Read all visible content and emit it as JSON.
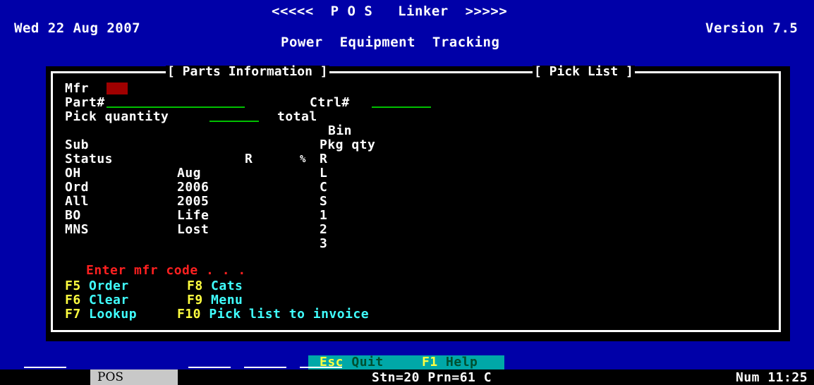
{
  "header": {
    "date": "Wed 22 Aug 2007",
    "title": "<<<<<  P O S   Linker  >>>>>",
    "subtitle": "Power  Equipment  Tracking",
    "version": "Version 7.5"
  },
  "panel": {
    "parts_title": "[ Parts Information ]",
    "picklist_title": "[ Pick List ]"
  },
  "fields": {
    "mfr_label": "Mfr",
    "part_label": "Part#",
    "ctrl_label": "Ctrl#",
    "pick_qty_label": "Pick quantity",
    "total_label": "total"
  },
  "labels": {
    "bin": "Bin",
    "sub": "Sub",
    "pkg_qty": "Pkg qty",
    "status": "Status",
    "r_col": "R",
    "pct": "%",
    "r2": "R",
    "rows_left": [
      "OH",
      "Ord",
      "All",
      "BO",
      "MNS"
    ],
    "rows_mid": [
      "Aug",
      "2006",
      "2005",
      "Life",
      "Lost"
    ],
    "rows_right": [
      "L",
      "C",
      "S",
      "1",
      "2",
      "3"
    ]
  },
  "prompt": "Enter mfr code . . .",
  "fkeys": [
    {
      "key": "F5",
      "label": "Order"
    },
    {
      "key": "F6",
      "label": "Clear"
    },
    {
      "key": "F7",
      "label": "Lookup"
    },
    {
      "key": "F8",
      "label": "Cats"
    },
    {
      "key": "F9",
      "label": "Menu"
    },
    {
      "key": "F10",
      "label": "Pick list to invoice"
    }
  ],
  "help": {
    "esc_key": "Esc",
    "esc_label": "Quit",
    "f1_key": "F1",
    "f1_label": "Help"
  },
  "status": {
    "pos_tab": "POS",
    "station": "Stn=20 Prn=61 C",
    "clock": "Num 11:25"
  },
  "colors": {
    "background": "#0000a8",
    "panel": "#000000",
    "input_underline": "#00c000",
    "mfr_input": "#a00000",
    "prompt": "#ff2020",
    "fkey": "#ffff40",
    "fkey_label": "#40ffff",
    "help_bar": "#00a8a8"
  }
}
